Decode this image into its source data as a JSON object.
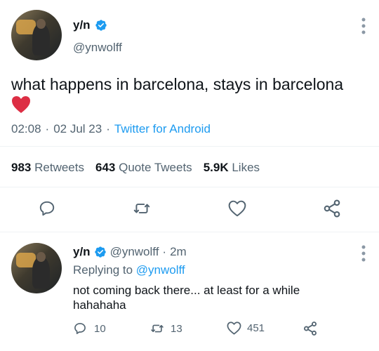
{
  "main_tweet": {
    "author_name": "y/n",
    "author_handle": "@ynwolff",
    "text": "what happens in barcelona, stays in barcelona",
    "emoji": "❤️",
    "time": "02:08",
    "date": "02 Jul 23",
    "source": "Twitter for Android",
    "stats": {
      "retweets_count": "983",
      "retweets_label": "Retweets",
      "quotes_count": "643",
      "quotes_label": "Quote Tweets",
      "likes_count": "5.9K",
      "likes_label": "Likes"
    }
  },
  "reply": {
    "author_name": "y/n",
    "author_handle": "@ynwolff",
    "time_ago": "2m",
    "replying_prefix": "Replying to",
    "replying_to": "@ynwolff",
    "text_line1": "not coming back there... at least for a while",
    "text_line2": "hahahaha",
    "replies_count": "10",
    "retweets_count": "13",
    "likes_count": "451"
  },
  "colors": {
    "accent": "#1d9bf0",
    "text": "#0f1419",
    "muted": "#536471",
    "divider": "#eff3f4"
  },
  "icons": [
    "more-vertical-icon",
    "verified-badge-icon",
    "reply-icon",
    "retweet-icon",
    "like-icon",
    "share-icon"
  ]
}
